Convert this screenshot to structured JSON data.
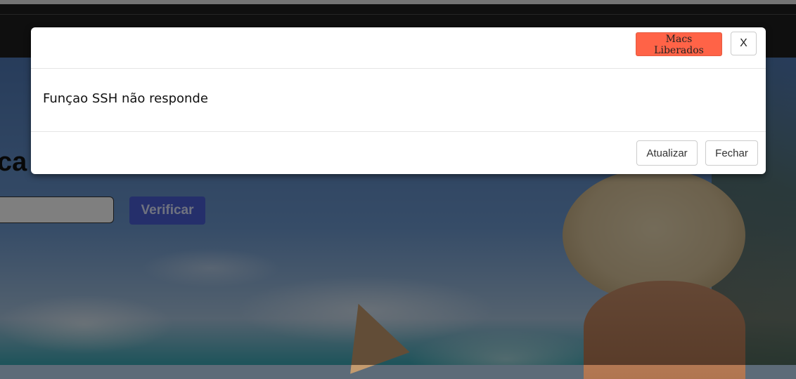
{
  "background_page": {
    "heading": "ca",
    "verify_button": "Verificar"
  },
  "modal": {
    "header": {
      "macs_button": "Macs Liberados",
      "close_button": "X"
    },
    "body": {
      "message": "Funçao SSH não responde"
    },
    "footer": {
      "refresh_button": "Atualizar",
      "close_button": "Fechar"
    }
  },
  "colors": {
    "macs_button_bg": "#ff6347",
    "verify_button_bg": "#4b5fd6",
    "backdrop": "rgba(0,0,0,0.5)"
  }
}
